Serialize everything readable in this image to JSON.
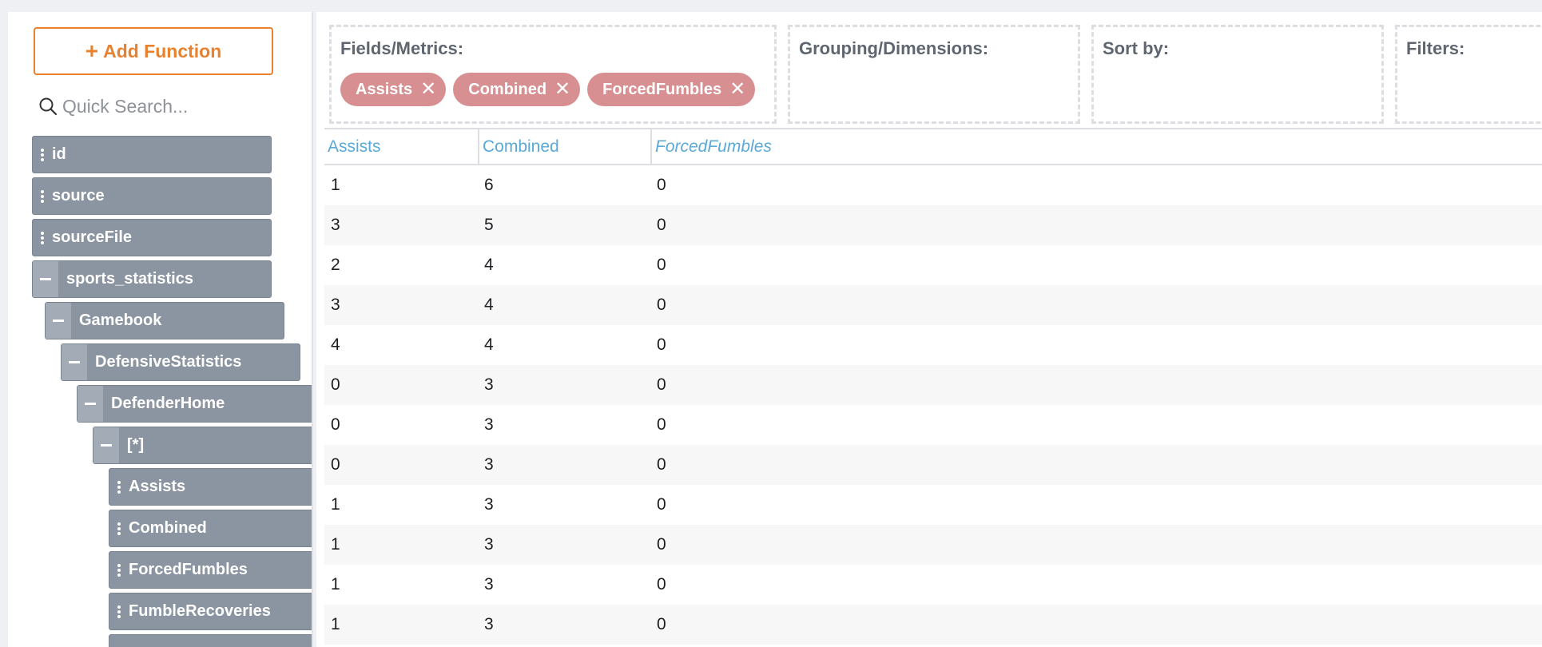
{
  "sidebar": {
    "add_function_label": "Add Function",
    "search_placeholder": "Quick Search...",
    "nodes": [
      {
        "label": "id",
        "kind": "field"
      },
      {
        "label": "source",
        "kind": "field"
      },
      {
        "label": "sourceFile",
        "kind": "field"
      },
      {
        "label": "sports_statistics",
        "kind": "group"
      },
      {
        "label": "Gamebook",
        "kind": "group"
      },
      {
        "label": "DefensiveStatistics",
        "kind": "group"
      },
      {
        "label": "DefenderHome",
        "kind": "group"
      },
      {
        "label": "[*]",
        "kind": "group"
      },
      {
        "label": "Assists",
        "kind": "field"
      },
      {
        "label": "Combined",
        "kind": "field"
      },
      {
        "label": "ForcedFumbles",
        "kind": "field"
      },
      {
        "label": "FumbleRecoveries",
        "kind": "field"
      }
    ]
  },
  "dropzones": {
    "fields_title": "Fields/Metrics:",
    "fields_chips": [
      "Assists",
      "Combined",
      "ForcedFumbles"
    ],
    "grouping_title": "Grouping/Dimensions:",
    "sort_title": "Sort by:",
    "filters_title": "Filters:"
  },
  "table": {
    "columns": [
      "Assists",
      "Combined",
      "ForcedFumbles"
    ],
    "rows": [
      [
        "1",
        "6",
        "0"
      ],
      [
        "3",
        "5",
        "0"
      ],
      [
        "2",
        "4",
        "0"
      ],
      [
        "3",
        "4",
        "0"
      ],
      [
        "4",
        "4",
        "0"
      ],
      [
        "0",
        "3",
        "0"
      ],
      [
        "0",
        "3",
        "0"
      ],
      [
        "0",
        "3",
        "0"
      ],
      [
        "1",
        "3",
        "0"
      ],
      [
        "1",
        "3",
        "0"
      ],
      [
        "1",
        "3",
        "0"
      ],
      [
        "1",
        "3",
        "0"
      ]
    ]
  },
  "colors": {
    "accent": "#e8822f",
    "chip": "#d88f91",
    "node": "#8b94a1",
    "header_link": "#5aa9d6"
  }
}
